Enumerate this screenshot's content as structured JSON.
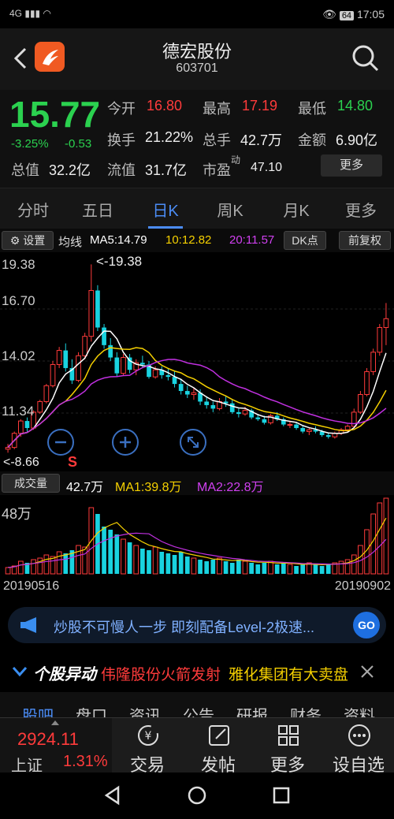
{
  "status": {
    "signal": "4G",
    "battery": "64",
    "time": "17:05"
  },
  "header": {
    "name": "德宏股份",
    "code": "603701",
    "back_icon": "back-arrow-icon",
    "search_icon": "search-icon"
  },
  "quote": {
    "price": "15.77",
    "change_pct": "-3.25%",
    "change": "-0.53",
    "open_label": "今开",
    "open": "16.80",
    "high_label": "最高",
    "high": "17.19",
    "low_label": "最低",
    "low": "14.80",
    "turnover_label": "换手",
    "turnover": "21.22%",
    "volume_label": "总手",
    "volume": "42.7万",
    "amount_label": "金额",
    "amount": "6.90亿",
    "total_cap_label": "总值",
    "total_cap": "32.2亿",
    "float_cap_label": "流值",
    "float_cap": "31.7亿",
    "pe_label": "市盈",
    "pe_sup": "动",
    "pe": "47.10",
    "more_label": "更多"
  },
  "tabs": [
    "分时",
    "五日",
    "日K",
    "周K",
    "月K",
    "更多"
  ],
  "active_tab": "日K",
  "ma_row": {
    "settings": "设置",
    "label": "均线",
    "ma5": "MA5:14.79",
    "ma10": "10:12.82",
    "ma20": "20:11.57",
    "dk": "DK点",
    "adjust": "前复权"
  },
  "kchart": {
    "y_labels": [
      "19.38",
      "16.70",
      "14.02",
      "11.34"
    ],
    "high_marker": "<-19.38",
    "low_marker": "<-8.66",
    "s_marker": "S"
  },
  "vol_row": {
    "label": "成交量",
    "vol": "42.7万",
    "ma1": "MA1:39.8万",
    "ma2": "MA2:22.8万",
    "axis_label": "48万"
  },
  "dates": {
    "start": "20190516",
    "end": "20190902"
  },
  "banner": {
    "text": "炒股不可慢人一步 即刻配备Level-2极速...",
    "go": "GO"
  },
  "news": {
    "logo": "个股异动",
    "item1": "伟隆股份火箭发射",
    "item2": "雅化集团有大卖盘"
  },
  "subtabs": [
    "股吧",
    "盘口",
    "资讯",
    "公告",
    "研报",
    "财务",
    "资料"
  ],
  "bottom": {
    "index_value": "2924.11",
    "index_name": "上证",
    "index_change": "1.31%",
    "items": [
      "交易",
      "发帖",
      "更多",
      "设自选"
    ]
  },
  "colors": {
    "up": "#ff3b3b",
    "down": "#19d3e0",
    "ma5": "#ffffff",
    "ma10": "#f5d000",
    "ma20": "#c030e0",
    "accent": "#4b8cf5"
  },
  "chart_data": {
    "type": "candlestick",
    "x_start": "20190516",
    "x_end": "20190902",
    "ylim": [
      8.66,
      19.38
    ],
    "ohlc": [
      [
        8.9,
        9.2,
        8.7,
        9.0
      ],
      [
        9.0,
        9.9,
        8.9,
        9.8
      ],
      [
        9.8,
        10.6,
        9.6,
        10.5
      ],
      [
        10.5,
        10.7,
        9.9,
        10.1
      ],
      [
        10.1,
        11.1,
        10.0,
        11.0
      ],
      [
        11.0,
        11.7,
        10.9,
        11.6
      ],
      [
        11.6,
        12.6,
        11.5,
        12.5
      ],
      [
        12.5,
        13.9,
        12.4,
        13.7
      ],
      [
        13.7,
        14.7,
        13.5,
        14.5
      ],
      [
        14.5,
        14.9,
        13.3,
        13.5
      ],
      [
        13.5,
        14.0,
        12.6,
        12.8
      ],
      [
        12.8,
        14.4,
        12.7,
        14.2
      ],
      [
        14.2,
        15.5,
        14.0,
        15.3
      ],
      [
        15.3,
        19.38,
        15.0,
        17.9
      ],
      [
        17.9,
        18.2,
        15.6,
        15.8
      ],
      [
        15.8,
        16.0,
        14.6,
        14.8
      ],
      [
        14.8,
        15.2,
        13.9,
        14.1
      ],
      [
        14.1,
        14.4,
        13.0,
        13.2
      ],
      [
        13.2,
        14.3,
        13.1,
        14.1
      ],
      [
        14.1,
        14.3,
        13.2,
        13.4
      ],
      [
        13.4,
        14.0,
        13.1,
        13.8
      ],
      [
        13.8,
        14.2,
        13.5,
        13.7
      ],
      [
        13.7,
        13.9,
        12.9,
        13.0
      ],
      [
        13.0,
        13.6,
        12.9,
        13.4
      ],
      [
        13.4,
        13.6,
        12.9,
        13.1
      ],
      [
        13.1,
        13.5,
        12.8,
        13.0
      ],
      [
        13.0,
        13.3,
        12.4,
        12.6
      ],
      [
        12.6,
        12.9,
        12.0,
        12.2
      ],
      [
        12.2,
        12.5,
        11.8,
        12.0
      ],
      [
        12.0,
        12.4,
        11.7,
        12.1
      ],
      [
        12.1,
        12.3,
        11.4,
        11.6
      ],
      [
        11.6,
        11.9,
        11.2,
        11.4
      ],
      [
        11.4,
        11.6,
        11.0,
        11.2
      ],
      [
        11.2,
        11.8,
        11.1,
        11.6
      ],
      [
        11.6,
        11.9,
        11.3,
        11.5
      ],
      [
        11.5,
        11.7,
        10.9,
        11.0
      ],
      [
        11.0,
        11.2,
        10.7,
        10.9
      ],
      [
        10.9,
        11.3,
        10.8,
        11.1
      ],
      [
        11.1,
        11.2,
        10.6,
        10.7
      ],
      [
        10.7,
        10.9,
        10.5,
        10.6
      ],
      [
        10.6,
        10.8,
        10.3,
        10.4
      ],
      [
        10.4,
        10.9,
        10.3,
        10.8
      ],
      [
        10.8,
        11.0,
        10.5,
        10.6
      ],
      [
        10.6,
        10.7,
        10.2,
        10.3
      ],
      [
        10.3,
        10.5,
        10.1,
        10.3
      ],
      [
        10.3,
        10.4,
        10.0,
        10.1
      ],
      [
        10.1,
        10.2,
        9.8,
        9.9
      ],
      [
        9.9,
        10.1,
        9.7,
        10.0
      ],
      [
        10.0,
        10.2,
        9.8,
        9.9
      ],
      [
        9.9,
        10.0,
        9.6,
        9.7
      ],
      [
        9.7,
        9.8,
        9.5,
        9.6
      ],
      [
        9.6,
        9.9,
        9.5,
        9.8
      ],
      [
        9.8,
        10.1,
        9.7,
        10.0
      ],
      [
        10.0,
        10.3,
        9.9,
        10.2
      ],
      [
        10.2,
        11.2,
        10.1,
        11.0
      ],
      [
        11.0,
        12.2,
        10.9,
        12.0
      ],
      [
        12.0,
        13.5,
        11.9,
        13.3
      ],
      [
        13.3,
        14.6,
        13.1,
        14.4
      ],
      [
        14.4,
        16.0,
        14.2,
        15.8
      ],
      [
        15.8,
        17.19,
        14.8,
        16.3
      ]
    ],
    "volume": [
      4,
      5,
      8,
      7,
      9,
      10,
      12,
      11,
      14,
      13,
      15,
      18,
      17,
      42,
      38,
      30,
      28,
      25,
      22,
      20,
      18,
      16,
      15,
      17,
      14,
      13,
      12,
      14,
      11,
      10,
      9,
      8,
      9,
      10,
      8,
      7,
      9,
      8,
      7,
      6,
      7,
      8,
      6,
      7,
      6,
      5,
      6,
      7,
      6,
      5,
      6,
      7,
      8,
      9,
      12,
      18,
      28,
      38,
      45,
      48
    ]
  }
}
